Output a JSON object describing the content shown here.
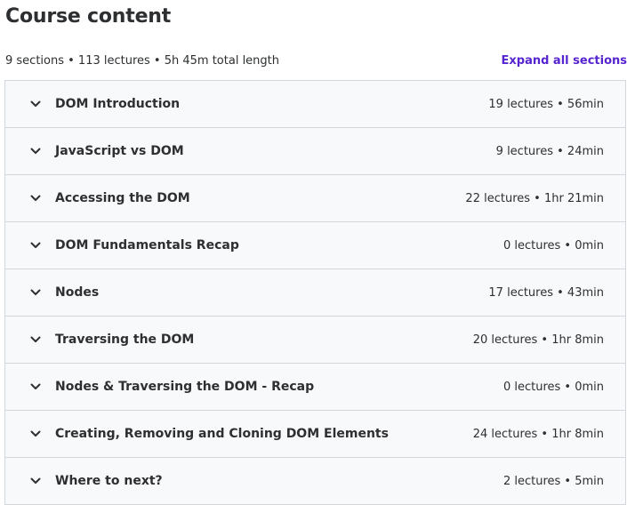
{
  "header": {
    "title": "Course content",
    "summary": "9 sections • 113 lectures • 5h 45m total length",
    "expand_all_label": "Expand all sections"
  },
  "icons": {
    "section_toggle": "chevron-down-icon"
  },
  "colors": {
    "accent": "#5624d0",
    "text": "#2d2f31",
    "section_bg": "#f7f9fa",
    "border": "#d1d7dc"
  },
  "sections": [
    {
      "title": "DOM Introduction",
      "meta": "19 lectures • 56min"
    },
    {
      "title": "JavaScript vs DOM",
      "meta": "9 lectures • 24min"
    },
    {
      "title": "Accessing the DOM",
      "meta": "22 lectures • 1hr 21min"
    },
    {
      "title": "DOM Fundamentals Recap",
      "meta": "0 lectures • 0min"
    },
    {
      "title": "Nodes",
      "meta": "17 lectures • 43min"
    },
    {
      "title": "Traversing the DOM",
      "meta": "20 lectures • 1hr 8min"
    },
    {
      "title": "Nodes & Traversing the DOM - Recap",
      "meta": "0 lectures • 0min"
    },
    {
      "title": "Creating, Removing and Cloning DOM Elements",
      "meta": "24 lectures • 1hr 8min"
    },
    {
      "title": "Where to next?",
      "meta": "2 lectures • 5min"
    }
  ]
}
